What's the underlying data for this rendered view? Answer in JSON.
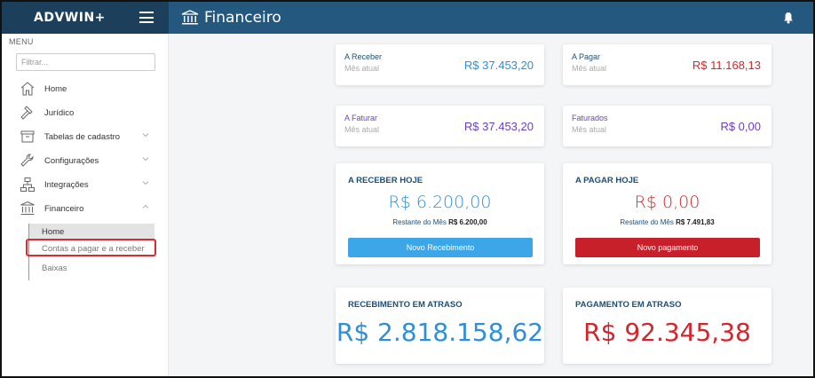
{
  "app": {
    "logo": "ADVWIN+"
  },
  "header": {
    "title": "Financeiro"
  },
  "sidebar": {
    "menu_label": "MENU",
    "filter_placeholder": "Filtrar...",
    "items": [
      {
        "label": "Home",
        "icon": "home-icon"
      },
      {
        "label": "Jurídico",
        "icon": "gavel-icon"
      },
      {
        "label": "Tabelas de cadastro",
        "icon": "archive-box-icon"
      },
      {
        "label": "Configurações",
        "icon": "wrench-icon"
      },
      {
        "label": "Integrações",
        "icon": "network-icon"
      },
      {
        "label": "Financeiro",
        "icon": "bank-icon"
      }
    ],
    "sub_items": [
      {
        "label": "Home"
      },
      {
        "label": "Contas a pagar e a receber"
      },
      {
        "label": "Baixas"
      }
    ]
  },
  "summary": {
    "a_receber": {
      "title": "A Receber",
      "sub": "Mês atual",
      "value": "R$ 37.453,20"
    },
    "a_pagar": {
      "title": "A Pagar",
      "sub": "Mês atual",
      "value": "R$ 11.168,13"
    },
    "a_faturar": {
      "title": "A Faturar",
      "sub": "Mês atual",
      "value": "R$ 37.453,20"
    },
    "faturados": {
      "title": "Faturados",
      "sub": "Mês atual",
      "value": "R$ 0,00"
    }
  },
  "today": {
    "receber": {
      "title": "A RECEBER HOJE",
      "value": "R$ 6.200,00",
      "rest_label": "Restante do Mês",
      "rest_value": "R$ 6.200,00",
      "button": "Novo Recebimento"
    },
    "pagar": {
      "title": "A PAGAR HOJE",
      "value": "R$ 0,00",
      "rest_label": "Restante do Mês",
      "rest_value": "R$ 7.491,83",
      "button": "Novo pagamento"
    }
  },
  "late": {
    "recebimento": {
      "title": "RECEBIMENTO EM ATRASO",
      "value": "R$ 2.818.158,62"
    },
    "pagamento": {
      "title": "PAGAMENTO EM ATRASO",
      "value": "R$ 92.345,38"
    }
  },
  "colors": {
    "sidebar_dark": "#1c3f5c",
    "header": "#24587f",
    "blue": "#2e8fd6",
    "red": "#d3262b",
    "purple": "#6a3fbf",
    "highlight": "#e0292c"
  }
}
